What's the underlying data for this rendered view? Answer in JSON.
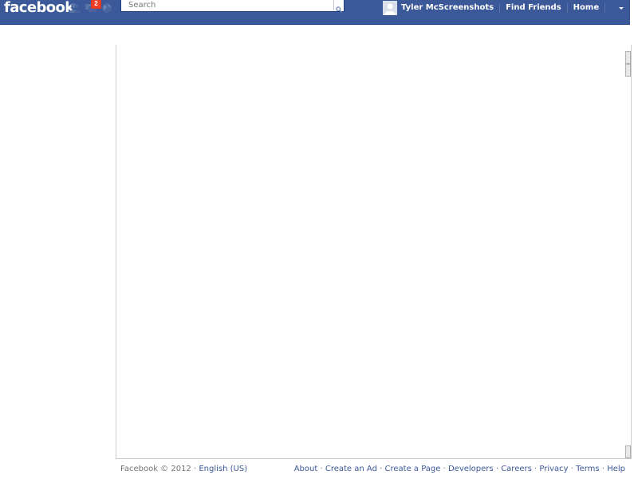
{
  "topbar": {
    "logo": "facebook",
    "notification_count": "2",
    "search": {
      "placeholder": "Search",
      "value": ""
    },
    "user_name": "Tyler McScreenshots",
    "find_friends": "Find Friends",
    "home": "Home",
    "icons": {
      "friend_requests": "friend-requests-icon",
      "messages": "messages-icon",
      "notifications": "globe-icon",
      "search": "search-icon",
      "account_menu": "chevron-down-icon"
    },
    "colors": {
      "bar": "#3b5998",
      "badge": "#f03d25"
    }
  },
  "footer": {
    "copyright": "Facebook © 2012",
    "separator": "·",
    "language": "English (US)",
    "links": [
      "About",
      "Create an Ad",
      "Create a Page",
      "Developers",
      "Careers",
      "Privacy",
      "Terms",
      "Help"
    ]
  }
}
